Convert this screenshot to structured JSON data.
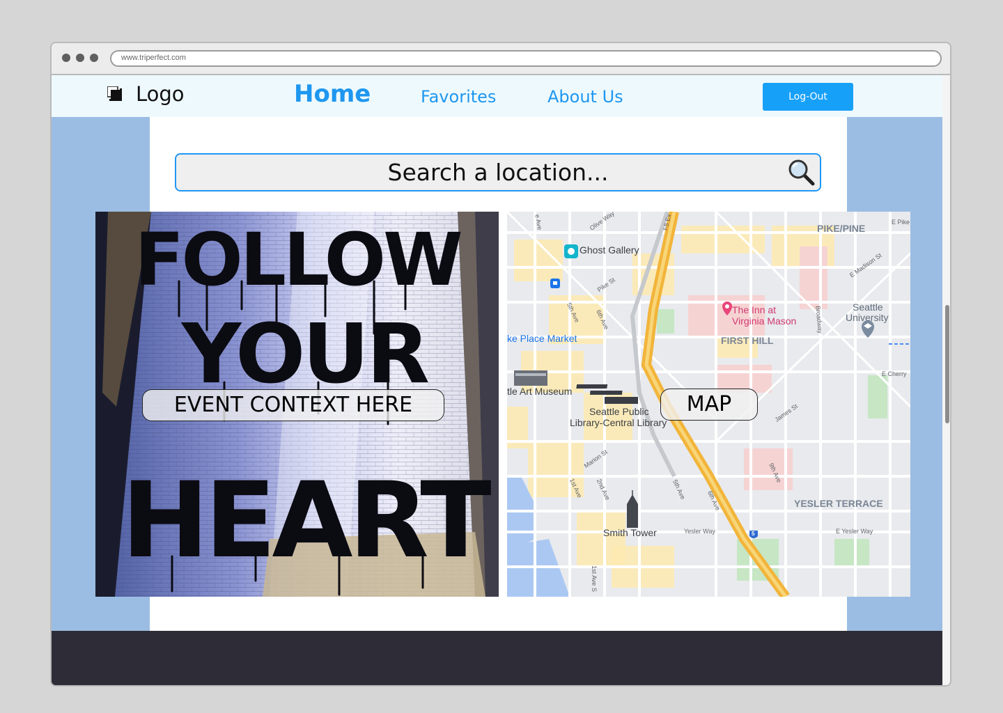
{
  "browser": {
    "url": "www.triperfect.com"
  },
  "nav": {
    "logo_text": "Logo",
    "home": "Home",
    "favorites": "Favorites",
    "about": "About Us",
    "logout": "Log-Out"
  },
  "search": {
    "placeholder": "Search a location...",
    "icon": "magnifying-glass-icon"
  },
  "event": {
    "context_label": "EVENT CONTEXT HERE",
    "mural_lines": [
      "FOLLOW",
      "YOUR",
      "HEART"
    ]
  },
  "map": {
    "label": "MAP",
    "neighborhoods": {
      "pike_pine": "PIKE/PINE",
      "first_hill": "FIRST HILL",
      "yesler_terrace": "YESLER TERRACE"
    },
    "places": {
      "ghost_gallery": "Ghost Gallery",
      "inn_line1": "The Inn at",
      "inn_line2": "Virginia Mason",
      "university_line1": "Seattle",
      "university_line2": "University",
      "place_market": "ke Place Market",
      "art_museum": "tle Art Museum",
      "library_line1": "Seattle Public",
      "library_line2": "Library-Central Library",
      "smith_tower": "Smith Tower"
    },
    "streets": {
      "olive": "Olive Way",
      "i5": "I-5 Ex",
      "e_pike": "E Pike",
      "e_madison": "E Madison St",
      "pike_st": "Pike St",
      "fifth_ave": "5th Ave",
      "sixth_ave": "6th Ave",
      "broadway": "Broadway",
      "e_cherry": "E Cherry",
      "james": "James St",
      "marion": "Marion St",
      "first_ave": "1st Ave",
      "second_ave": "2nd Ave",
      "fifth_ave_s": "5th Ave",
      "sixth_ave_s": "6th Ave",
      "ninth_ave": "9th Ave",
      "yesler": "Yesler Way",
      "e_yesler": "E Yesler Way",
      "first_ave_s": "1st Ave S",
      "ave_top": "e Ave",
      "i5_shield": "5"
    }
  },
  "colors": {
    "accent": "#1e97f0",
    "button": "#17a0f8",
    "page_bg": "#9bbde3",
    "nav_bg": "#eef9fd",
    "footer_bg": "#2e2c36",
    "search_border": "#2196f3"
  }
}
